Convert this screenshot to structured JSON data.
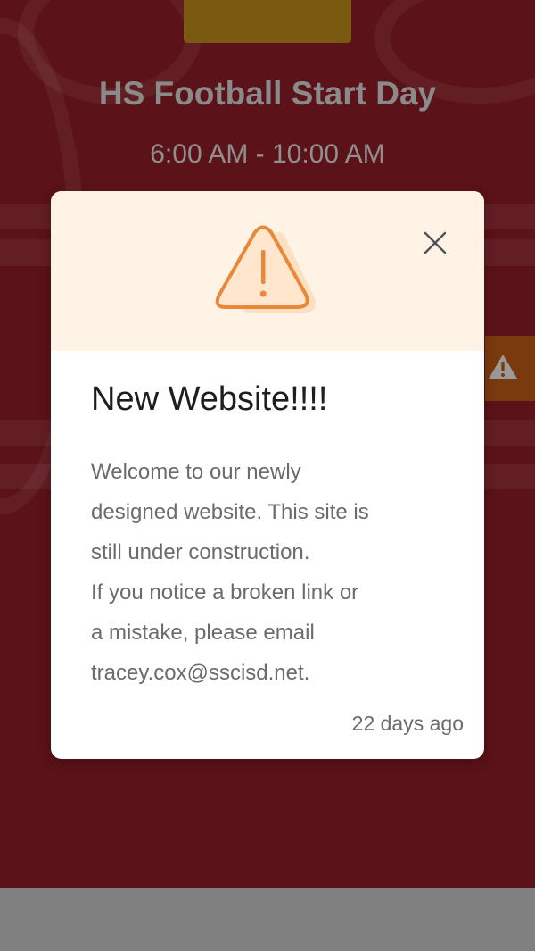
{
  "event": {
    "title": "HS Football Start Day",
    "time": "6:00 AM - 10:00 AM"
  },
  "alert_modal": {
    "icon": "warning-triangle-icon",
    "title": "New Website!!!!",
    "message_lines": [
      "Welcome to our newly",
      "designed website. This site is",
      "still under construction.",
      "If you notice a broken link or",
      "a mistake, please email",
      "tracey.cox@sscisd.net."
    ],
    "timestamp": "22 days ago"
  },
  "colors": {
    "background": "#5b1219",
    "accent_gold": "#7a5a10",
    "warning_orange": "#e8883a",
    "modal_header_bg": "#fef3e5",
    "footer": "#808080"
  }
}
